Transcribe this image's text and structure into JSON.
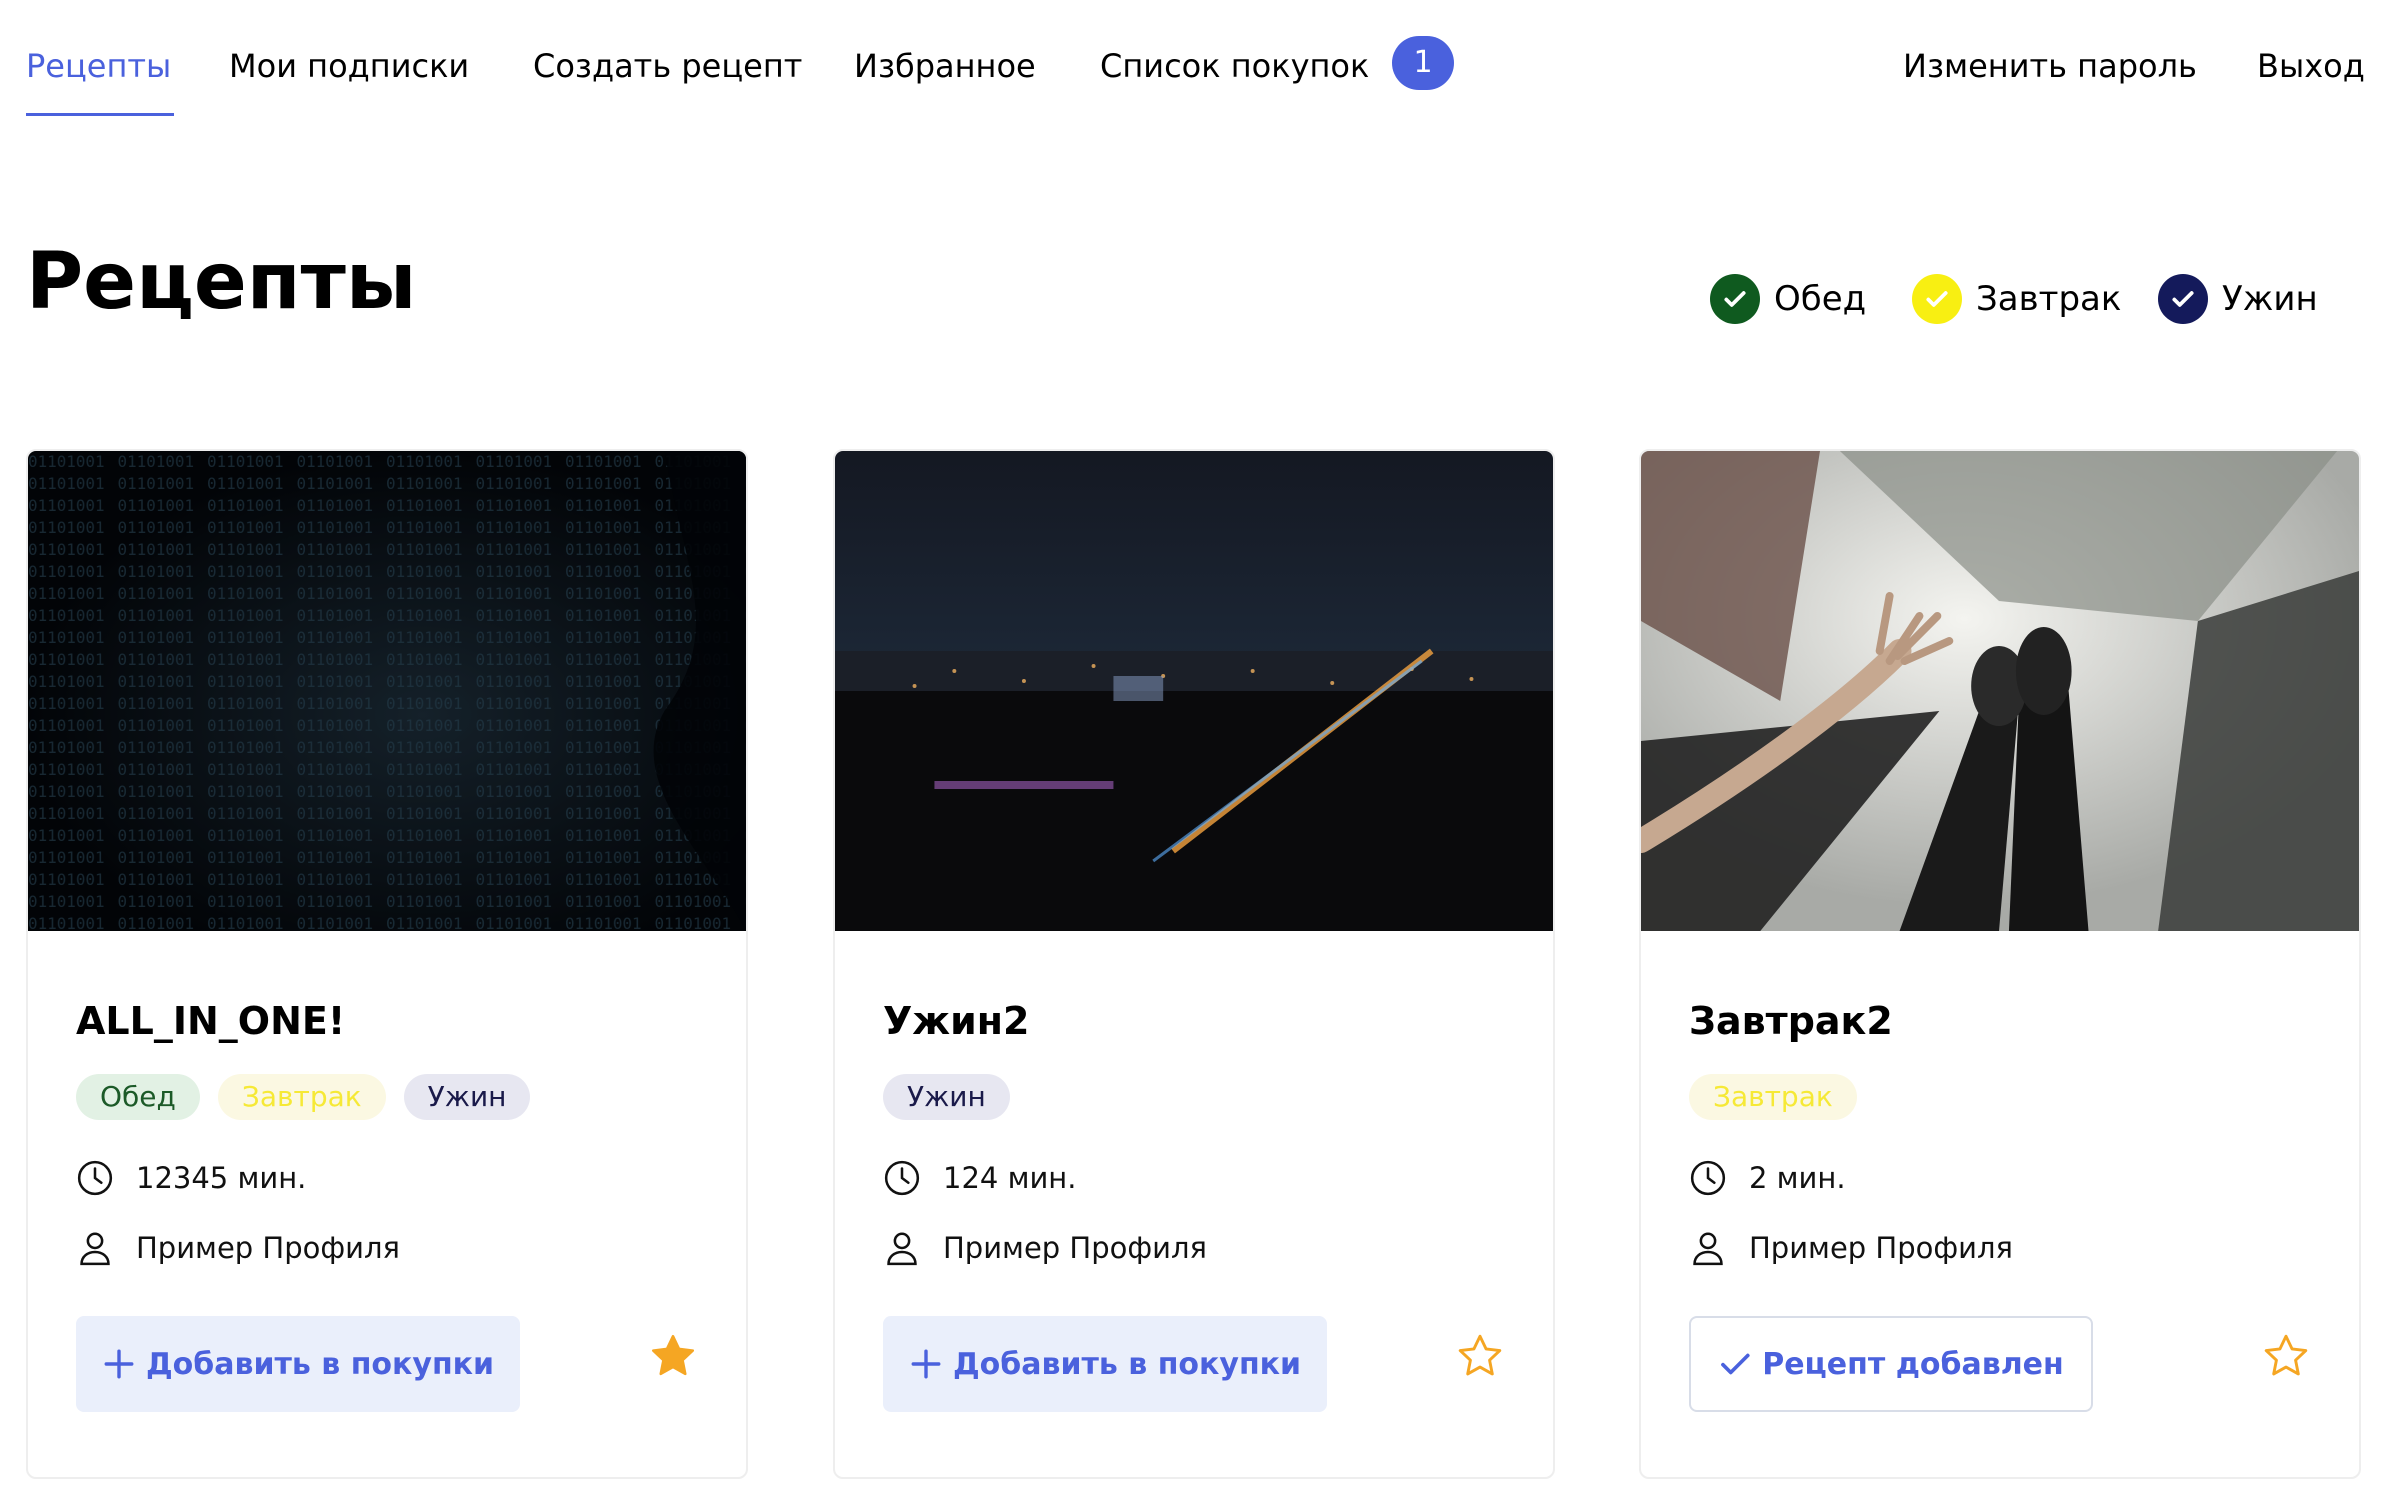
{
  "nav": {
    "recipes": "Рецепты",
    "subscriptions": "Мои подписки",
    "create": "Создать рецепт",
    "favorites": "Избранное",
    "shopping_list": "Список покупок",
    "shopping_count": "1",
    "change_password": "Изменить пароль",
    "logout": "Выход"
  },
  "page": {
    "title": "Рецепты"
  },
  "filters": [
    {
      "label": "Обед",
      "color": "#0f5a1f",
      "checked": true
    },
    {
      "label": "Завтрак",
      "color": "#f8ef12",
      "checked": true
    },
    {
      "label": "Ужин",
      "color": "#141a5b",
      "checked": true
    }
  ],
  "cards": [
    {
      "title": "ALL_IN_ONE!",
      "tags": [
        "Обед",
        "Завтрак",
        "Ужин"
      ],
      "time": "12345 мин.",
      "author": "Пример Профиля",
      "button": "Добавить в покупки",
      "favorite": true
    },
    {
      "title": "Ужин2",
      "tags": [
        "Ужин"
      ],
      "time": "124 мин.",
      "author": "Пример Профиля",
      "button": "Добавить в покупки",
      "favorite": false
    },
    {
      "title": "Завтрак2",
      "tags": [
        "Завтрак"
      ],
      "time": "2 мин.",
      "author": "Пример Профиля",
      "button": "Рецепт добавлен",
      "favorite": false
    }
  ],
  "colors": {
    "accent": "#4a61dd",
    "star": "#f5a623"
  }
}
